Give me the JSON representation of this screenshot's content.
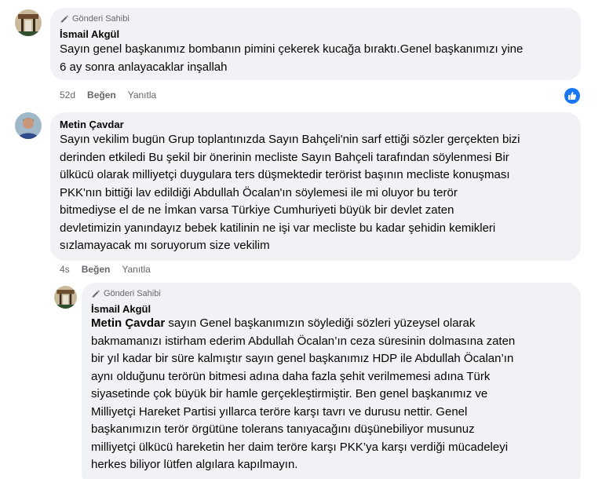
{
  "comments": [
    {
      "badge": "Gönderi Sahibi",
      "author": "İsmail Akgül",
      "lines": [
        "Sayın genel başkanımız bombanın pimini çekerek kucağa bıraktı.Genel başkanımızı yine",
        "6 ay sonra anlayacaklar inşallah"
      ],
      "time": "52d",
      "like_label": "Beğen",
      "reply_label": "Yanıtla",
      "reaction_icon": "like-reaction-icon"
    },
    {
      "author": "Metin Çavdar",
      "lines": [
        "Sayın vekilim bugün Grup toplantınızda Sayın Bahçeli'nin sarf ettiği sözler gerçekten bizi",
        "derinden etkiledi Bu şekil bir önerinin mecliste Sayın Bahçeli tarafından söylenmesi Bir",
        "ülkücü olarak milliyetçi duygulara ters düşmektedir terörist başının mecliste konuşması",
        "PKK'nın bittiği lav edildiği Abdullah Öcalan'ın söylemesi ile mi oluyor bu terör",
        "bitmediyse el de ne İmkan varsa Türkiye Cumhuriyeti büyük bir devlet zaten",
        "devletimizin yanındayız bebek katilinin ne işi var mecliste bu kadar şehidin kemikleri",
        "sızlamayacak mı soruyorum size vekilim"
      ],
      "time": "4s",
      "like_label": "Beğen",
      "reply_label": "Yanıtla"
    }
  ],
  "reply": {
    "badge": "Gönderi Sahibi",
    "author": "İsmail Akgül",
    "mention": "Metin Çavdar",
    "first_line_rest": " sayın Genel başkanımızın söylediği sözleri yüzeysel olarak",
    "lines": [
      "bakmamanızı istirham ederim Abdullah Öcalan’ın ceza süresinin dolmasına zaten",
      "bir yıl kadar bir süre kalmıştır sayın genel başkanımız HDP ile Abdullah Öcalan’ın",
      "aynı olduğunu terörün bitmesi adına daha fazla şehit verilmemesi adına Türk",
      "siyasetinde çok büyük bir hamle gerçekleştirmiştir. Ben genel başkanımız ve",
      "Milliyetçi Hareket Partisi yıllarca teröre karşı tavrı ve durusu nettir. Genel",
      "başkanımızın terör örgütüne tolerans tanıyacağını düşünebiliyor musunuz",
      "milliyetçi ülkücü hareketin her daim teröre karşı PKK’ya karşı verdiği mücadeleyi",
      "herkes biliyor lütfen algılara kapılmayın."
    ]
  },
  "colors": {
    "bubble": "#f0f2f5",
    "meta": "#65676b",
    "like_blue": "#1877f2"
  }
}
